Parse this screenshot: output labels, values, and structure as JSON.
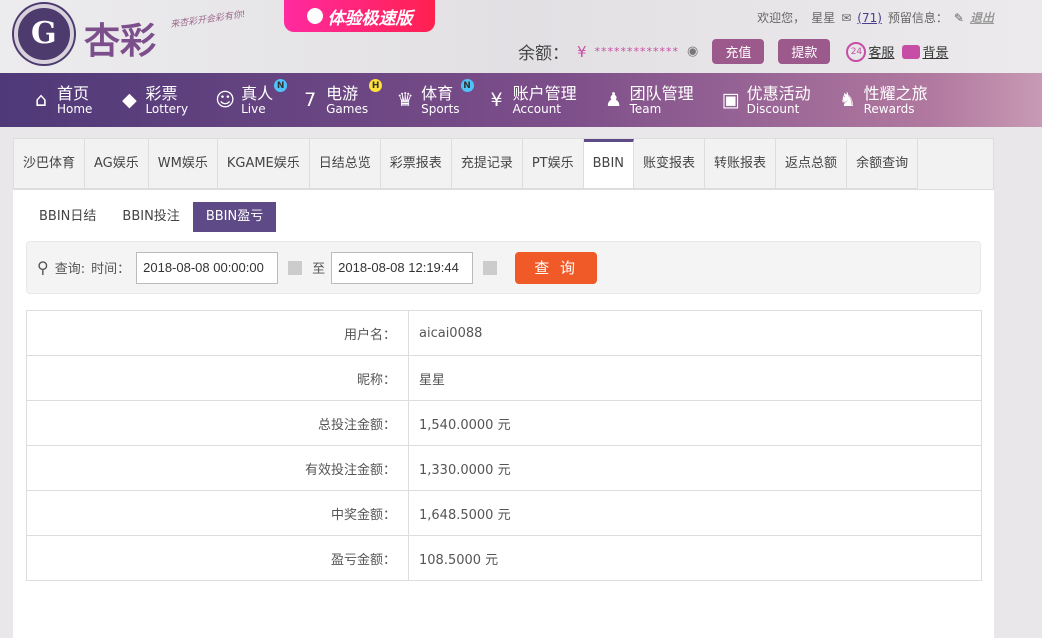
{
  "header": {
    "logo_text": "杏彩",
    "slogan": "来杏彩开会彩有你!",
    "speed_label": "体验极速版",
    "welcome": "欢迎您，",
    "username": "星星",
    "messages": "(71)",
    "reserve_info": "预留信息：",
    "logout": "退出",
    "balance_label": "余额：",
    "currency": "¥",
    "balance_masked": "*************",
    "deposit": "充值",
    "withdraw": "提款",
    "service": "客服",
    "service_badge": "24",
    "background": "背景"
  },
  "nav": [
    {
      "cn": "首页",
      "en": "Home",
      "icon": "home-icon",
      "glyph": "⌂"
    },
    {
      "cn": "彩票",
      "en": "Lottery",
      "icon": "ticket-icon",
      "glyph": "◆"
    },
    {
      "cn": "真人",
      "en": "Live",
      "icon": "dealer-icon",
      "glyph": "☺",
      "badge": "N",
      "badge_color": "#4fc3f7"
    },
    {
      "cn": "电游",
      "en": "Games",
      "icon": "seven-icon",
      "glyph": "7",
      "badge": "H",
      "badge_color": "#ffe13a"
    },
    {
      "cn": "体育",
      "en": "Sports",
      "icon": "trophy-icon",
      "glyph": "♛",
      "badge": "N",
      "badge_color": "#4fc3f7"
    },
    {
      "cn": "账户管理",
      "en": "Account",
      "icon": "yen-coin-icon",
      "glyph": "¥"
    },
    {
      "cn": "团队管理",
      "en": "Team",
      "icon": "team-icon",
      "glyph": "♟"
    },
    {
      "cn": "优惠活动",
      "en": "Discount",
      "icon": "gift-icon",
      "glyph": "▣"
    },
    {
      "cn": "性耀之旅",
      "en": "Rewards",
      "icon": "rewards-icon",
      "glyph": "♞"
    }
  ],
  "tabs": [
    "沙巴体育",
    "AG娱乐",
    "WM娱乐",
    "KGAME娱乐",
    "日结总览",
    "彩票报表",
    "充提记录",
    "PT娱乐",
    "BBIN",
    "账变报表",
    "转账报表",
    "返点总额",
    "余额查询"
  ],
  "active_tab": "BBIN",
  "subtabs": [
    "BBIN日结",
    "BBIN投注",
    "BBIN盈亏"
  ],
  "search": {
    "query_label": "查询:",
    "time_label": "时间：",
    "start": "2018-08-08 00:00:00",
    "to": "至",
    "end": "2018-08-08 12:19:44",
    "button": "查 询"
  },
  "rows": [
    {
      "label": "用户名：",
      "value": "aicai0088"
    },
    {
      "label": "昵称：",
      "value": "星星"
    },
    {
      "label": "总投注金额：",
      "value": "1,540.0000 元"
    },
    {
      "label": "有效投注金额：",
      "value": "1,330.0000 元"
    },
    {
      "label": "中奖金额：",
      "value": "1,648.5000 元"
    },
    {
      "label": "盈亏金额：",
      "value": "108.5000 元"
    }
  ]
}
